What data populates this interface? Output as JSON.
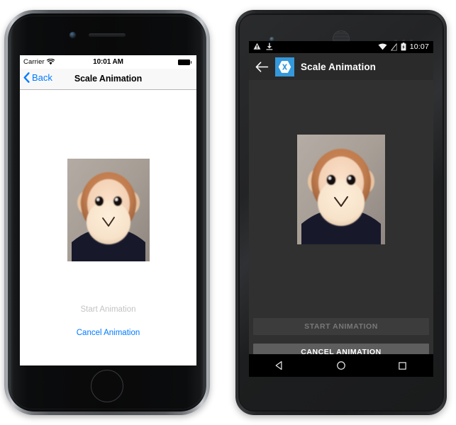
{
  "ios": {
    "device_name": "iPhone",
    "status_bar": {
      "carrier": "Carrier",
      "wifi_icon": "wifi-icon",
      "time": "10:01 AM",
      "battery_icon": "battery-full-icon"
    },
    "nav_bar": {
      "back_label": "Back",
      "back_icon": "chevron-left-icon",
      "title": "Scale Animation"
    },
    "content": {
      "image_name": "monkey-photo"
    },
    "buttons": {
      "start_label": "Start Animation",
      "start_enabled": false,
      "cancel_label": "Cancel Animation",
      "cancel_enabled": true
    },
    "colors": {
      "tint": "#007aff",
      "disabled": "#c3c3c6",
      "navbar_bg": "#f8f8f8",
      "screen_bg": "#ffffff"
    }
  },
  "android": {
    "device_name": "Nexus",
    "status_bar": {
      "warning_icon": "warning-triangle-icon",
      "download_icon": "download-icon",
      "wifi_icon": "wifi-icon",
      "signal_icon": "signal-off-icon",
      "battery_icon": "battery-charging-icon",
      "time": "10:07"
    },
    "app_bar": {
      "back_icon": "arrow-left-icon",
      "logo_icon": "xamarin-logo-icon",
      "title": "Scale Animation"
    },
    "content": {
      "image_name": "monkey-photo"
    },
    "buttons": {
      "start_label": "START ANIMATION",
      "start_enabled": false,
      "cancel_label": "CANCEL ANIMATION",
      "cancel_enabled": true
    },
    "nav_bar": {
      "back_icon": "nav-back-triangle-icon",
      "home_icon": "nav-home-circle-icon",
      "recents_icon": "nav-recents-square-icon"
    },
    "colors": {
      "accent": "#3498db",
      "screen_bg": "#303030",
      "appbar_bg": "#2a2a2a",
      "btn_disabled_bg": "#3c3c3c",
      "btn_enabled_bg": "#5e5e5e"
    }
  }
}
